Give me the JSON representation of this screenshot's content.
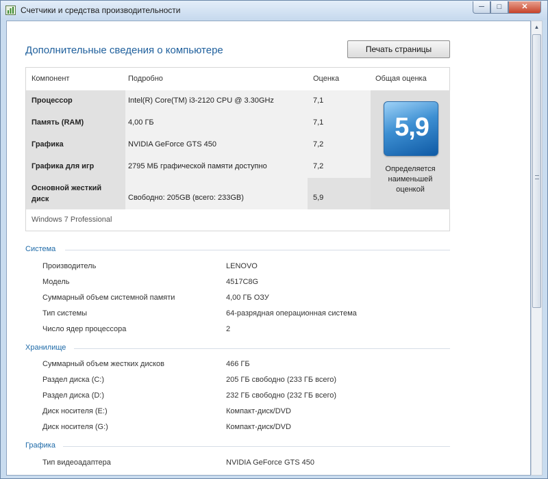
{
  "window": {
    "title": "Счетчики и средства производительности",
    "controls": {
      "minimize": "─",
      "maximize": "□",
      "close": "✕"
    }
  },
  "page": {
    "title": "Дополнительные сведения о компьютере",
    "print_button": "Печать страницы"
  },
  "score_table": {
    "headers": {
      "component": "Компонент",
      "details": "Подробно",
      "rating": "Оценка",
      "overall": "Общая оценка"
    },
    "rows": [
      {
        "component": "Процессор",
        "details": "Intel(R) Core(TM) i3-2120 CPU @ 3.30GHz",
        "rating": "7,1"
      },
      {
        "component": "Память (RAM)",
        "details": "4,00 ГБ",
        "rating": "7,1"
      },
      {
        "component": "Графика",
        "details": "NVIDIA GeForce GTS 450",
        "rating": "7,2"
      },
      {
        "component": "Графика для игр",
        "details": "2795 МБ графической памяти доступно",
        "rating": "7,2"
      },
      {
        "component": "Основной жесткий диск",
        "details": "Свободно: 205GB (всего: 233GB)",
        "rating": "5,9"
      }
    ],
    "overall_score": "5,9",
    "overall_note": "Определяется наименьшей оценкой",
    "edition": "Windows 7 Professional",
    "badge_color": "#3d8fd2"
  },
  "system": {
    "header": "Система",
    "items": [
      {
        "label": "Производитель",
        "value": "LENOVO"
      },
      {
        "label": "Модель",
        "value": "4517C8G"
      },
      {
        "label": "Суммарный объем системной памяти",
        "value": "4,00 ГБ ОЗУ"
      },
      {
        "label": "Тип системы",
        "value": "64-разрядная операционная система"
      },
      {
        "label": "Число ядер процессора",
        "value": "2"
      }
    ]
  },
  "storage": {
    "header": "Хранилище",
    "items": [
      {
        "label": "Суммарный объем жестких дисков",
        "value": "466 ГБ"
      },
      {
        "label": "Раздел диска (C:)",
        "value": "205 ГБ свободно (233 ГБ всего)"
      },
      {
        "label": "Раздел диска (D:)",
        "value": "232 ГБ свободно (232 ГБ всего)"
      },
      {
        "label": "Диск носителя (E:)",
        "value": "Компакт-диск/DVD"
      },
      {
        "label": "Диск носителя (G:)",
        "value": "Компакт-диск/DVD"
      }
    ]
  },
  "graphics": {
    "header": "Графика",
    "items": [
      {
        "label": "Тип видеоадаптера",
        "value": "NVIDIA GeForce GTS 450"
      }
    ]
  },
  "icons": [
    "app-icon",
    "scroll-up-icon"
  ]
}
